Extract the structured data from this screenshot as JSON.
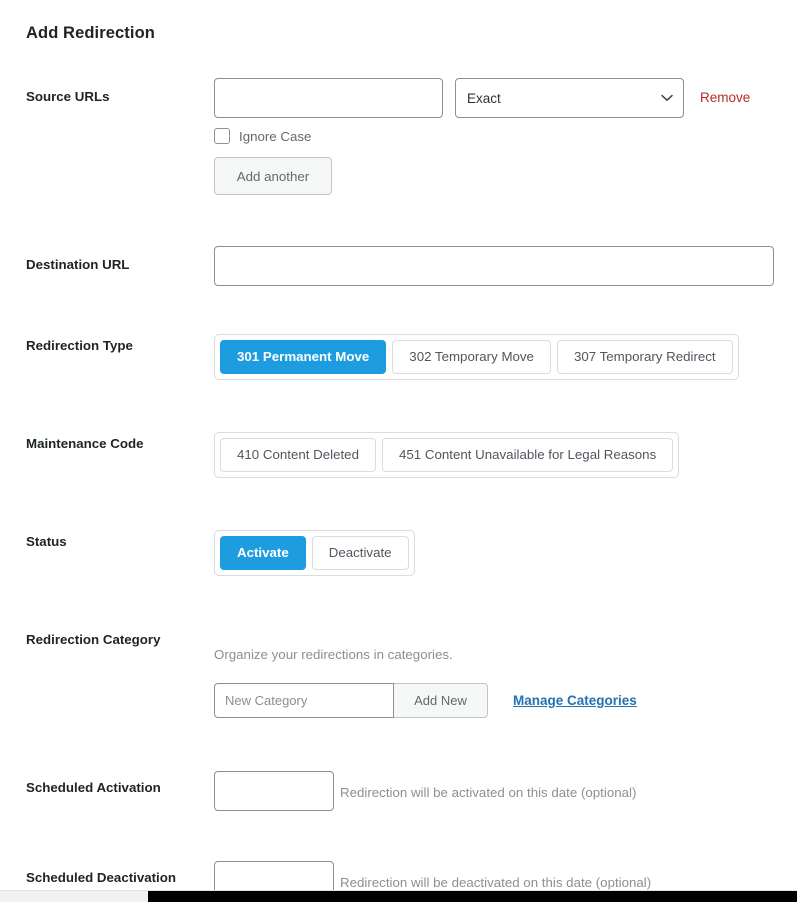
{
  "page": {
    "title": "Add Redirection"
  },
  "source_urls": {
    "label": "Source URLs",
    "url_value": "",
    "url_placeholder": "",
    "match_type_selected": "Exact",
    "match_type_options": [
      "Exact"
    ],
    "remove_label": "Remove",
    "ignore_case_label": "Ignore Case",
    "ignore_case_checked": false,
    "add_another_label": "Add another",
    "chevron_icon": "chevron-down-icon"
  },
  "destination_url": {
    "label": "Destination URL",
    "value": "",
    "placeholder": ""
  },
  "redirection_type": {
    "label": "Redirection Type",
    "options": [
      {
        "label": "301 Permanent Move",
        "active": true
      },
      {
        "label": "302 Temporary Move",
        "active": false
      },
      {
        "label": "307 Temporary Redirect",
        "active": false
      }
    ]
  },
  "maintenance_code": {
    "label": "Maintenance Code",
    "options": [
      {
        "label": "410 Content Deleted",
        "active": false
      },
      {
        "label": "451 Content Unavailable for Legal Reasons",
        "active": false
      }
    ]
  },
  "status": {
    "label": "Status",
    "options": [
      {
        "label": "Activate",
        "active": true
      },
      {
        "label": "Deactivate",
        "active": false
      }
    ]
  },
  "redirection_category": {
    "label": "Redirection Category",
    "description": "Organize your redirections in categories.",
    "new_category_value": "",
    "new_category_placeholder": "New Category",
    "add_new_label": "Add New",
    "manage_categories_label": "Manage Categories"
  },
  "scheduled_activation": {
    "label": "Scheduled Activation",
    "value": "",
    "helper": "Redirection will be activated on this date (optional)"
  },
  "scheduled_deactivation": {
    "label": "Scheduled Deactivation",
    "value": "",
    "helper": "Redirection will be deactivated on this date (optional)"
  },
  "colors": {
    "accent_blue": "#1e9ce0",
    "link_blue": "#2271b1",
    "remove_red": "#b32d2e",
    "text_dark": "#1d2327",
    "text_muted": "#8c8f94",
    "border_grey": "#8c8f94"
  }
}
